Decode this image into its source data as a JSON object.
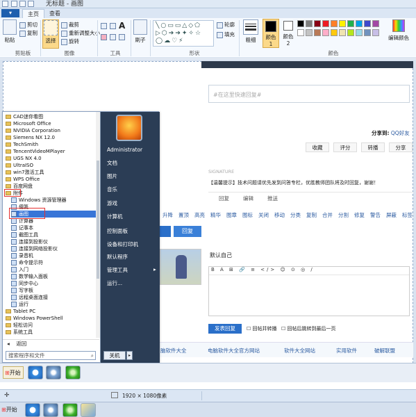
{
  "window": {
    "title": "无标题 - 画图"
  },
  "ribbon": {
    "tabs": [
      "主页",
      "查看"
    ],
    "clipboard": {
      "paste": "粘贴",
      "cut": "剪切",
      "copy": "复制",
      "label": "剪贴板"
    },
    "image": {
      "select": "选择",
      "crop": "裁剪",
      "resize": "重新调整大小",
      "rotate": "旋转",
      "label": "图像"
    },
    "tools_label": "工具",
    "brush": "刷子",
    "shapes": {
      "outline": "轮廓",
      "fill": "填充",
      "label": "形状"
    },
    "size": "粗细",
    "color1": "颜色 1",
    "color2": "颜色 2",
    "edit_colors": "编辑颜色",
    "colors_label": "颜色",
    "palette": [
      "#000000",
      "#7f7f7f",
      "#880015",
      "#ed1c24",
      "#ff7f27",
      "#fff200",
      "#22b14c",
      "#00a2e8",
      "#3f48cc",
      "#a349a4",
      "#ffffff",
      "#c3c3c3",
      "#b97a57",
      "#ffaec9",
      "#ffc90e",
      "#efe4b0",
      "#b5e61d",
      "#99d9ea",
      "#7092be",
      "#c8bfe7"
    ]
  },
  "browser": {
    "reply_placeholder": "#在这里快速回复#",
    "share_label": "分享到:",
    "share_target": "QQ好友",
    "buttons": [
      "收藏",
      "评分",
      "转播",
      "分享"
    ],
    "signature": "SIGNATURE",
    "tip": "【温馨提示】技术问题请优先发到问答专栏，优胜教师团队将及时回复，谢谢！",
    "action_row": [
      "回复",
      "编辑",
      "推送"
    ],
    "mod_row": [
      "升降",
      "置顶",
      "高亮",
      "精华",
      "图章",
      "图标",
      "关闭",
      "移动",
      "分类",
      "复制",
      "合并",
      "分割",
      "修复",
      "警告",
      "屏蔽",
      "标签"
    ],
    "reply_btn": "回复",
    "default_self": "默认自己",
    "reply_btn2": "发表回复",
    "chk1": "回帖并转播",
    "chk2": "回帖后跳转到最后一页",
    "links": [
      "脑软件大全",
      "电脑软件大全官方网站",
      "软件大全网站",
      "实用软件",
      "破解联盟"
    ]
  },
  "startmenu": {
    "programs": [
      {
        "label": "CAD迷你看图",
        "type": "folder"
      },
      {
        "label": "Microsoft Office",
        "type": "folder"
      },
      {
        "label": "NVIDIA Corporation",
        "type": "folder"
      },
      {
        "label": "Siemens NX 12.0",
        "type": "folder"
      },
      {
        "label": "TechSmith",
        "type": "folder"
      },
      {
        "label": "TencentVideoMPlayer",
        "type": "folder"
      },
      {
        "label": "UGS NX 4.0",
        "type": "folder"
      },
      {
        "label": "UltraISO",
        "type": "folder"
      },
      {
        "label": "win7激活工具",
        "type": "folder"
      },
      {
        "label": "WPS Office",
        "type": "folder"
      },
      {
        "label": "百度网盘",
        "type": "folder"
      },
      {
        "label": "附件",
        "type": "folder"
      },
      {
        "label": "Windows 资源管理器",
        "type": "app"
      },
      {
        "label": "便笺",
        "type": "app"
      },
      {
        "label": "画图",
        "type": "app"
      },
      {
        "label": "计算器",
        "type": "app"
      },
      {
        "label": "记事本",
        "type": "app"
      },
      {
        "label": "截图工具",
        "type": "app"
      },
      {
        "label": "连接到投影仪",
        "type": "app"
      },
      {
        "label": "连接到网络投影仪",
        "type": "app"
      },
      {
        "label": "录音机",
        "type": "app"
      },
      {
        "label": "命令提示符",
        "type": "app"
      },
      {
        "label": "入门",
        "type": "app"
      },
      {
        "label": "数学输入面板",
        "type": "app"
      },
      {
        "label": "同步中心",
        "type": "app"
      },
      {
        "label": "写字板",
        "type": "app"
      },
      {
        "label": "远程桌面连接",
        "type": "app"
      },
      {
        "label": "运行",
        "type": "app"
      },
      {
        "label": "Tablet PC",
        "type": "folder"
      },
      {
        "label": "Windows PowerShell",
        "type": "folder"
      },
      {
        "label": "轻松访问",
        "type": "folder"
      },
      {
        "label": "系统工具",
        "type": "folder"
      }
    ],
    "back": "返回",
    "search_placeholder": "搜索程序和文件",
    "shutdown": "关机",
    "right_items": [
      "Administrator",
      "文档",
      "图片",
      "音乐",
      "游戏",
      "计算机",
      "控制面板",
      "设备和打印机",
      "默认程序",
      "管理工具",
      "运行..."
    ]
  },
  "taskbar": {
    "start_label": "开始",
    "start_label2": "开始"
  },
  "statusbar": {
    "dimensions": "1920 × 1080像素"
  }
}
